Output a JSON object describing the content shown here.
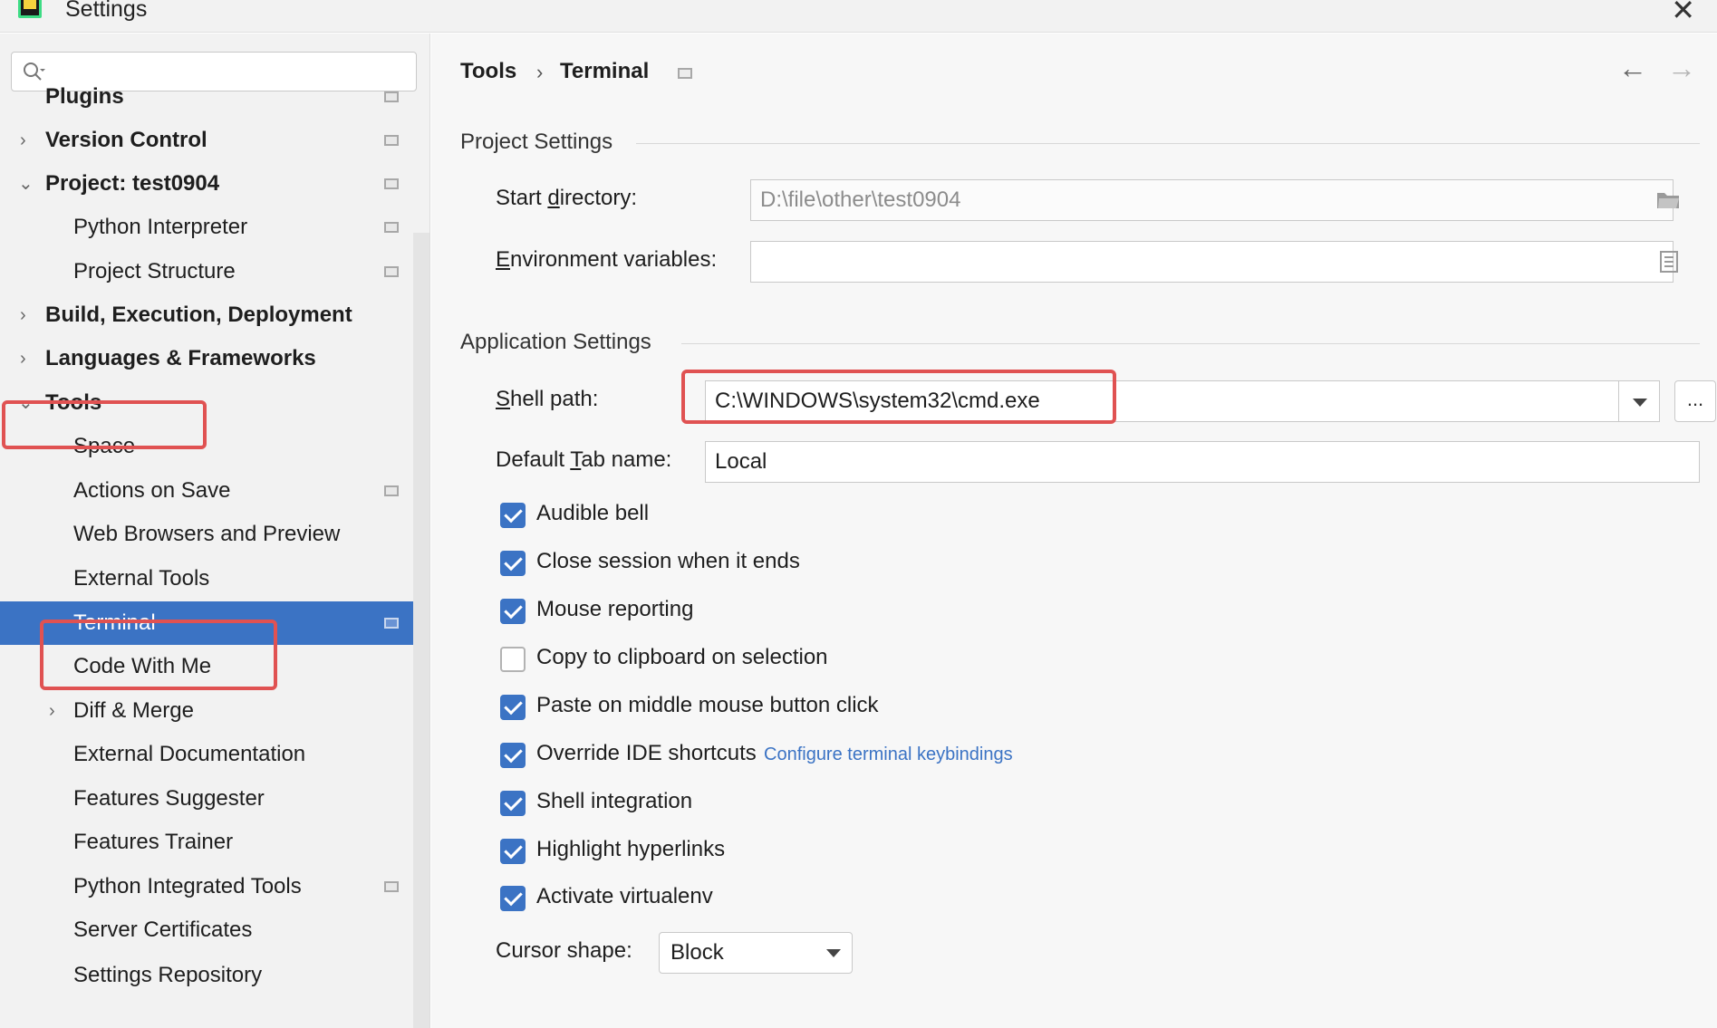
{
  "window": {
    "title": "Settings",
    "close_glyph": "✕"
  },
  "search": {
    "placeholder": ""
  },
  "sidebar": {
    "items": [
      {
        "label": "Plugins"
      },
      {
        "label": "Version Control"
      },
      {
        "label": "Project: test0904"
      },
      {
        "label": "Python Interpreter"
      },
      {
        "label": "Project Structure"
      },
      {
        "label": "Build, Execution, Deployment"
      },
      {
        "label": "Languages & Frameworks"
      },
      {
        "label": "Tools"
      },
      {
        "label": "Space"
      },
      {
        "label": "Actions on Save"
      },
      {
        "label": "Web Browsers and Preview"
      },
      {
        "label": "External Tools"
      },
      {
        "label": "Terminal"
      },
      {
        "label": "Code With Me"
      },
      {
        "label": "Diff & Merge"
      },
      {
        "label": "External Documentation"
      },
      {
        "label": "Features Suggester"
      },
      {
        "label": "Features Trainer"
      },
      {
        "label": "Python Integrated Tools"
      },
      {
        "label": "Server Certificates"
      },
      {
        "label": "Settings Repository"
      }
    ],
    "selected": "Terminal"
  },
  "breadcrumb": {
    "parent": "Tools",
    "separator": "›",
    "current": "Terminal"
  },
  "nav": {
    "back_glyph": "←",
    "forward_glyph": "→"
  },
  "project_settings": {
    "section_title": "Project Settings",
    "start_directory": {
      "label_pre": "Start ",
      "label_mnemonic": "d",
      "label_post": "irectory:",
      "value": "D:\\file\\other\\test0904"
    },
    "env_vars": {
      "label_mnemonic": "E",
      "label_post": "nvironment variables:",
      "value": ""
    }
  },
  "app_settings": {
    "section_title": "Application Settings",
    "shell_path": {
      "label_mnemonic": "S",
      "label_post": "hell path:",
      "value": "C:\\WINDOWS\\system32\\cmd.exe",
      "browse": "..."
    },
    "default_tab": {
      "label_pre": "Default ",
      "label_mnemonic": "T",
      "label_post": "ab name:",
      "value": "Local"
    },
    "checkboxes": [
      {
        "label": "Audible bell",
        "checked": true
      },
      {
        "label": "Close session when it ends",
        "checked": true
      },
      {
        "label": "Mouse reporting",
        "checked": true
      },
      {
        "label": "Copy to clipboard on selection",
        "checked": false
      },
      {
        "label": "Paste on middle mouse button click",
        "checked": true
      },
      {
        "label": "Override IDE shortcuts",
        "checked": true
      },
      {
        "label": "Shell integration",
        "checked": true
      },
      {
        "label": "Highlight hyperlinks",
        "checked": true
      },
      {
        "label": "Activate virtualenv",
        "checked": true
      }
    ],
    "keybindings_link": "Configure terminal keybindings",
    "cursor_shape": {
      "label": "Cursor shape:",
      "value": "Block"
    }
  },
  "colors": {
    "accent": "#3b73c4",
    "highlight_box": "#e05252"
  }
}
